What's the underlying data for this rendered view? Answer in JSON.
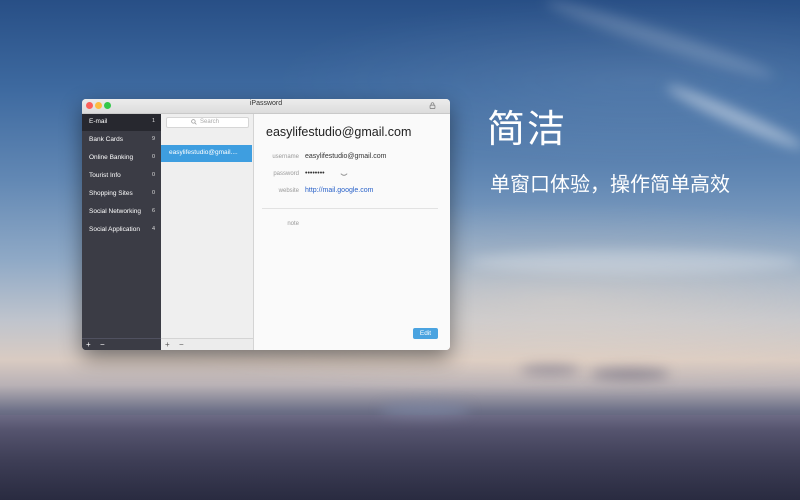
{
  "window": {
    "title": "iPassword"
  },
  "categories": [
    {
      "label": "E-mail",
      "count": "1"
    },
    {
      "label": "Bank Cards",
      "count": "9"
    },
    {
      "label": "Online Banking",
      "count": "0"
    },
    {
      "label": "Tourist Info",
      "count": "0"
    },
    {
      "label": "Shopping Sites",
      "count": "0"
    },
    {
      "label": "Social Networking",
      "count": "6"
    },
    {
      "label": "Social Application",
      "count": "4"
    }
  ],
  "sidebar_footer": {
    "add": "+",
    "remove": "−"
  },
  "list": {
    "search_placeholder": "Search",
    "items": [
      "easylifestudio@gmail...."
    ],
    "footer": {
      "add": "+",
      "remove": "−"
    }
  },
  "detail": {
    "title": "easylifestudio@gmail.com",
    "username_label": "username",
    "username_value": "easylifestudio@gmail.com",
    "password_label": "password",
    "password_value": "••••••••",
    "website_label": "website",
    "website_value": "http://mail.google.com",
    "note_label": "note",
    "edit_label": "Edit"
  },
  "promo": {
    "headline": "简洁",
    "subline": "单窗口体验，操作简单高效"
  },
  "colors": {
    "sidebar": "#3b3c45",
    "sidebar_active": "#27282f",
    "selection": "#3e9ee0",
    "edit_button": "#4aa3e0",
    "link": "#2a62c9"
  }
}
